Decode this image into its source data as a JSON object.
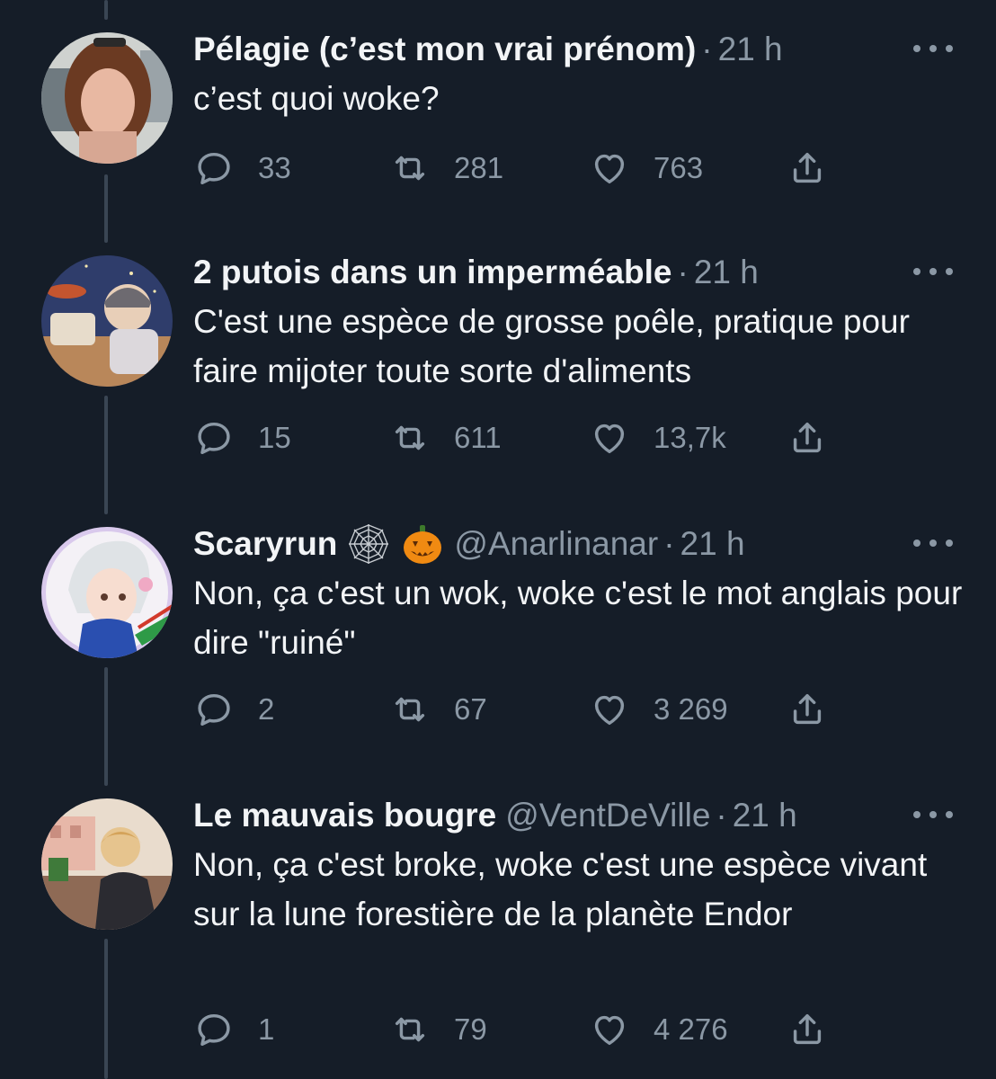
{
  "tweets": [
    {
      "name": "Pélagie (c’est mon vrai prénom)",
      "handle": "",
      "separator": "·",
      "time": "21 h",
      "text": "c’est quoi woke?",
      "replies": "33",
      "retweets": "281",
      "likes": "763",
      "emojis": []
    },
    {
      "name": "2 putois dans un imperméable",
      "handle": "",
      "separator": "·",
      "time": "21 h",
      "text": "C'est une espèce de grosse poêle, pratique pour faire mijoter toute sorte d'aliments",
      "replies": "15",
      "retweets": "611",
      "likes": "13,7k",
      "emojis": []
    },
    {
      "name": "Scaryrun",
      "handle": "@Anarlinanar",
      "separator": "·",
      "time": "21 h",
      "text": "Non, ça c'est un wok, woke c'est le mot anglais pour dire \"ruiné\"",
      "replies": "2",
      "retweets": "67",
      "likes": "3 269",
      "emojis": [
        "spider-web-icon",
        "jack-o-lantern-icon"
      ]
    },
    {
      "name": "Le mauvais bougre",
      "handle": "@VentDeVille",
      "separator": "·",
      "time": "21 h",
      "text": "Non, ça c'est broke, woke c'est une espèce vivant sur la lune forestière de la planète Endor",
      "replies": "1",
      "retweets": "79",
      "likes": "4 276",
      "emojis": []
    }
  ],
  "icons": {
    "reply": "reply-icon",
    "retweet": "retweet-icon",
    "like": "heart-icon",
    "share": "share-icon",
    "more": "more-icon"
  },
  "colors": {
    "background": "#151d28",
    "text": "#f2f4f6",
    "muted": "#8b98a5",
    "thread_line": "#3a4654"
  }
}
